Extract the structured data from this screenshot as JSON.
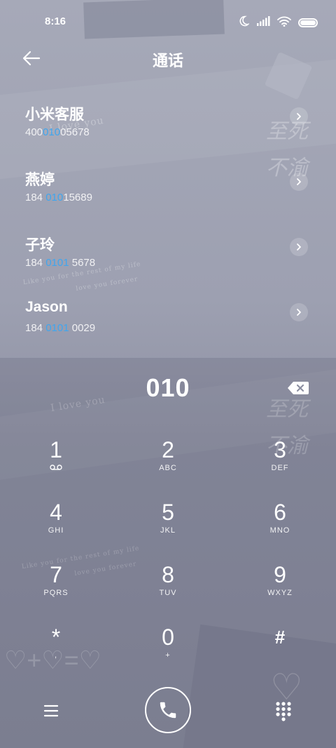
{
  "status_bar": {
    "time": "8:16",
    "icons": [
      "moon-icon",
      "signal-icon",
      "wifi-icon",
      "battery-icon"
    ]
  },
  "header": {
    "title": "通话",
    "back_icon": "arrow-left-icon"
  },
  "contacts": [
    {
      "name": "小米客服",
      "number_pre": "400",
      "number_match": "010",
      "number_post": "05678"
    },
    {
      "name": "燕婷",
      "number_pre": "184 ",
      "number_match": "010",
      "number_post": "15689"
    },
    {
      "name": "子玲",
      "number_pre": "184 ",
      "number_match": "0101",
      "number_post": " 5678"
    },
    {
      "name": "Jason",
      "number_pre": "184 ",
      "number_match": "0101",
      "number_post": " 0029"
    }
  ],
  "dialpad": {
    "input": "010",
    "keys": [
      {
        "digit": "1",
        "letters": ""
      },
      {
        "digit": "2",
        "letters": "ABC"
      },
      {
        "digit": "3",
        "letters": "DEF"
      },
      {
        "digit": "4",
        "letters": "GHI"
      },
      {
        "digit": "5",
        "letters": "JKL"
      },
      {
        "digit": "6",
        "letters": "MNO"
      },
      {
        "digit": "7",
        "letters": "PQRS"
      },
      {
        "digit": "8",
        "letters": "TUV"
      },
      {
        "digit": "9",
        "letters": "WXYZ"
      },
      {
        "digit": "*",
        "letters": ","
      },
      {
        "digit": "0",
        "letters": "+"
      },
      {
        "digit": "#",
        "letters": ""
      }
    ]
  },
  "colors": {
    "highlight": "#3fa6ef",
    "text": "#ffffff"
  },
  "wallpaper": {
    "script_line_1": "Like you for the rest of my life",
    "script_line_2": "love you forever",
    "cursive": "I love you",
    "cjk_1": "至死",
    "cjk_2": "不渝"
  }
}
